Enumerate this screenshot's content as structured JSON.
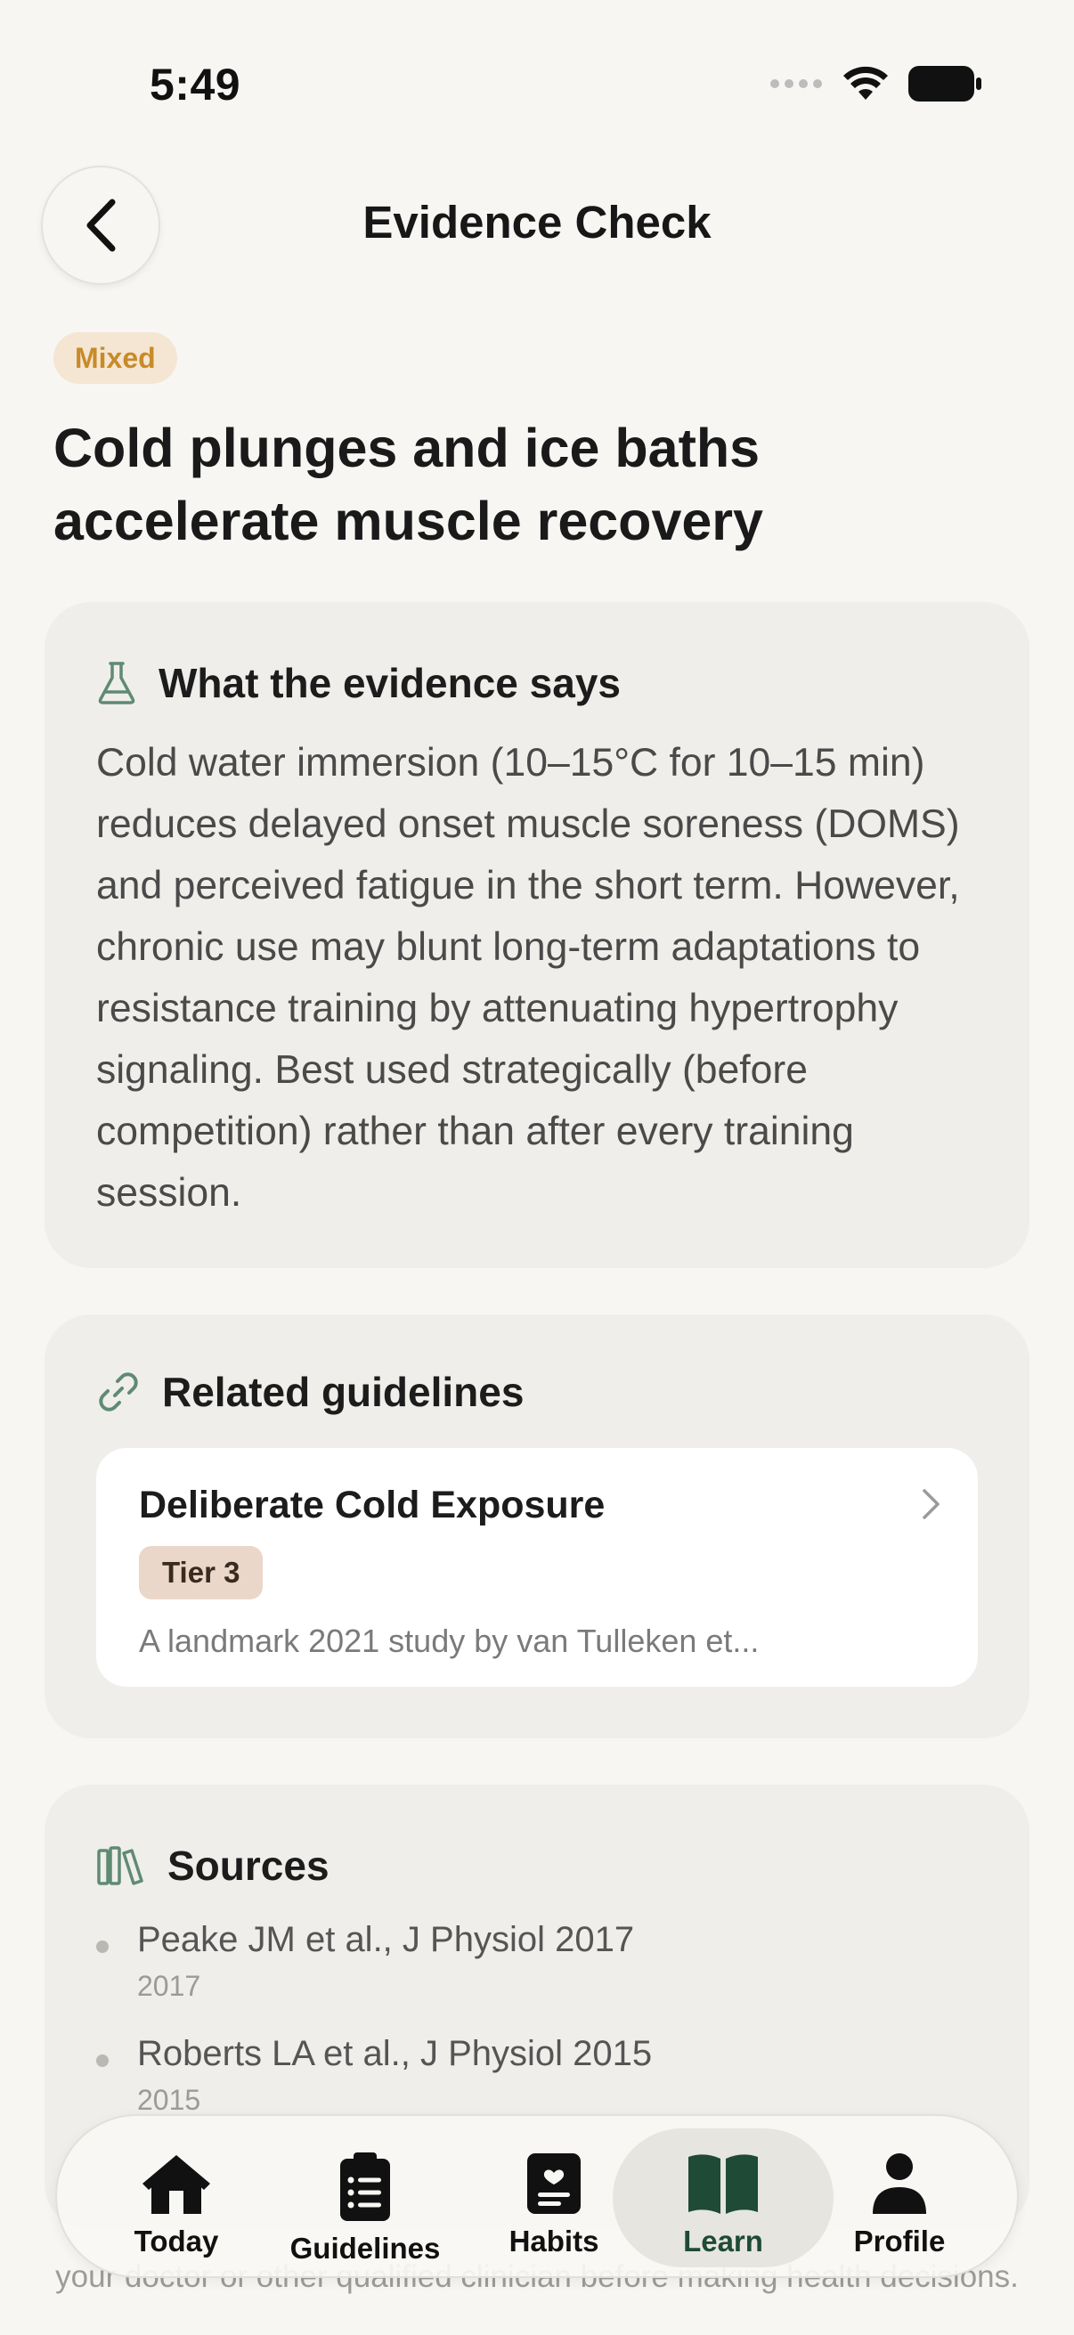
{
  "status_bar": {
    "time": "5:49"
  },
  "header": {
    "title": "Evidence Check"
  },
  "claim": {
    "verdict": "Mixed",
    "title": "Cold plunges and ice baths accelerate muscle recovery"
  },
  "evidence": {
    "heading": "What the evidence says",
    "body": "Cold water immersion (10–15°C for 10–15 min) reduces delayed onset muscle soreness (DOMS) and perceived fatigue in the short term. However, chronic use may blunt long-term adaptations to resistance training by attenuating hypertrophy signaling. Best used strategically (before competition) rather than after every training session."
  },
  "related": {
    "heading": "Related guidelines",
    "items": [
      {
        "title": "Deliberate Cold Exposure",
        "tier": "Tier 3",
        "snippet": "A landmark 2021 study by van Tulleken et..."
      }
    ]
  },
  "sources": {
    "heading": "Sources",
    "items": [
      {
        "title": "Peake JM et al., J Physiol 2017",
        "year": "2017"
      },
      {
        "title": "Roberts LA et al., J Physiol 2015",
        "year": "2015"
      }
    ]
  },
  "disclaimer": "your doctor or other qualified clinician before making health decisions.",
  "tab_bar": {
    "tabs": [
      {
        "label": "Today",
        "icon": "home-icon"
      },
      {
        "label": "Guidelines",
        "icon": "clipboard-icon"
      },
      {
        "label": "Habits",
        "icon": "journal-icon"
      },
      {
        "label": "Learn",
        "icon": "book-icon",
        "active": true
      },
      {
        "label": "Profile",
        "icon": "person-icon"
      }
    ]
  },
  "colors": {
    "accent": "#1e4a36",
    "verdict_bg": "#f4e6d3",
    "verdict_text": "#c98a28",
    "tier_bg": "#ead7c9",
    "icon_green": "#5f8a73"
  }
}
